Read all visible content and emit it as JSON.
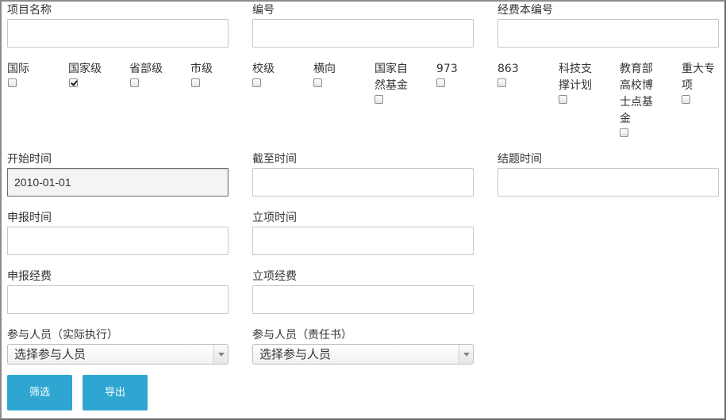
{
  "fields": {
    "project_name": {
      "label": "项目名称",
      "value": ""
    },
    "number": {
      "label": "编号",
      "value": ""
    },
    "budget_number": {
      "label": "经费本编号",
      "value": ""
    },
    "start_time": {
      "label": "开始时间",
      "value": "2010-01-01"
    },
    "deadline": {
      "label": "截至时间",
      "value": ""
    },
    "conclusion_time": {
      "label": "结题时间",
      "value": ""
    },
    "apply_time": {
      "label": "申报时间",
      "value": ""
    },
    "approval_time": {
      "label": "立项时间",
      "value": ""
    },
    "apply_funds": {
      "label": "申报经费",
      "value": ""
    },
    "approval_funds": {
      "label": "立项经费",
      "value": ""
    }
  },
  "levels": [
    {
      "label": "国际",
      "checked": false
    },
    {
      "label": "国家级",
      "checked": true
    },
    {
      "label": "省部级",
      "checked": false
    },
    {
      "label": "市级",
      "checked": false
    },
    {
      "label": "校级",
      "checked": false
    },
    {
      "label": "横向",
      "checked": false
    },
    {
      "label": "国家自然基金",
      "checked": false
    },
    {
      "label": "973",
      "checked": false
    },
    {
      "label": "863",
      "checked": false
    },
    {
      "label": "科技支撑计划",
      "checked": false
    },
    {
      "label": "教育部高校博士点基金",
      "checked": false
    },
    {
      "label": "重大专项",
      "checked": false
    }
  ],
  "participants_actual": {
    "label": "参与人员（实际执行）",
    "placeholder": "选择参与人员"
  },
  "participants_responsibility": {
    "label": "参与人员（责任书）",
    "placeholder": "选择参与人员"
  },
  "buttons": {
    "filter": "筛选",
    "export": "导出"
  }
}
